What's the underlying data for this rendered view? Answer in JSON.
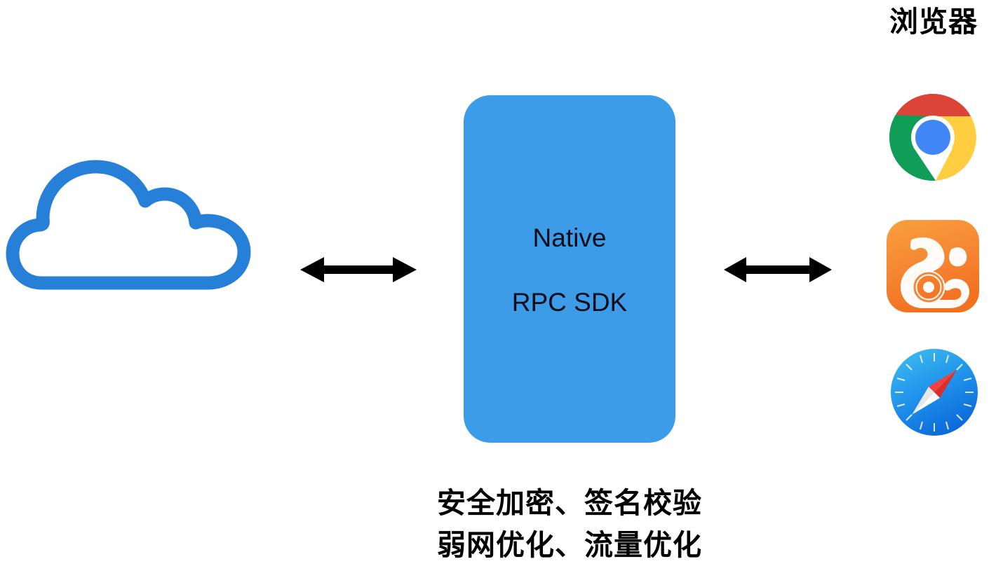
{
  "diagram": {
    "title": "Native RPC SDK 架构图",
    "background_color": "#ffffff",
    "accent_blue": "#3d9ce8",
    "cloud_stroke_color": "#2680d8",
    "arrow_color": "#000000"
  },
  "cloud": {
    "name": "cloud-icon",
    "label": "",
    "stroke_color": "#2680d8"
  },
  "center_box": {
    "line1": "Native",
    "line2": "RPC SDK",
    "fill_color": "#3d9ce8",
    "text_color": "#0d0d1a"
  },
  "arrows": [
    {
      "name": "arrow-cloud-to-sdk",
      "direction": "bidirectional",
      "color": "#000000"
    },
    {
      "name": "arrow-sdk-to-browsers",
      "direction": "bidirectional",
      "color": "#000000"
    }
  ],
  "browsers": {
    "heading": "浏览器",
    "items": [
      {
        "name": "chrome-icon",
        "label": "Chrome",
        "colors": {
          "red": "#DB4437",
          "green": "#0F9D58",
          "yellow": "#FFCD40",
          "blue": "#4285F4"
        }
      },
      {
        "name": "uc-browser-icon",
        "label": "UC Browser",
        "colors": {
          "orange_light": "#F9A03C",
          "orange_dark": "#F27121",
          "mark": "#FFFFFF"
        }
      },
      {
        "name": "safari-icon",
        "label": "Safari",
        "colors": {
          "blue_light": "#3BB8F0",
          "blue_dark": "#0A64D8",
          "needle_red": "#F4413C",
          "needle_white": "#FFFFFF"
        }
      }
    ]
  },
  "caption": {
    "line1": "安全加密、签名校验",
    "line2": "弱网优化、流量优化"
  }
}
